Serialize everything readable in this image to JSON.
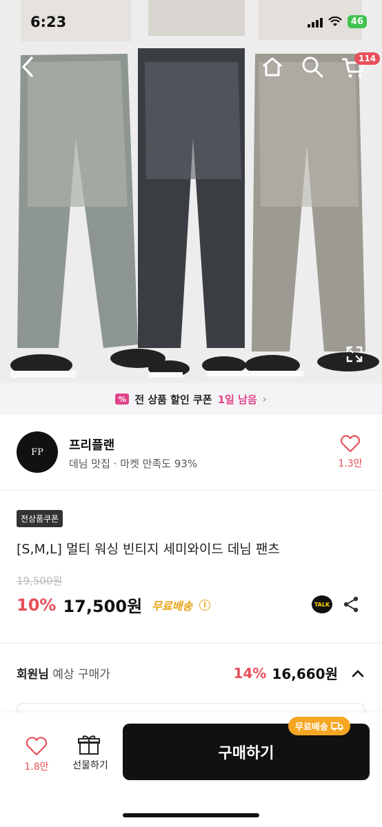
{
  "status_bar": {
    "time": "6:23",
    "battery": "46"
  },
  "nav": {
    "cart_count": "114"
  },
  "coupon_strip": {
    "text": "전 상품 할인 쿠폰",
    "days": "1일 남음"
  },
  "store": {
    "logo_text": "FP",
    "name": "프리플랜",
    "meta": "데님 맛집 · 마켓 만족도 93%",
    "like_count": "1.3만"
  },
  "product": {
    "badge": "전상품쿠폰",
    "title": "[S,M,L] 멀티 워싱 빈티지 세미와이드 데님 팬츠",
    "original_price": "19,500원",
    "discount": "10%",
    "price": "17,500원",
    "free_shipping": "무료배송"
  },
  "member": {
    "label_bold": "회원님",
    "label_sub": "예상 구매가",
    "discount": "14%",
    "price": "16,660원"
  },
  "bottom_bar": {
    "like_count": "1.8만",
    "gift_label": "선물하기",
    "buy_label": "구매하기",
    "ship_chip": "무료배송"
  },
  "icons": [
    "back-icon",
    "home-icon",
    "search-icon",
    "cart-icon",
    "expand-icon",
    "heart-icon",
    "gift-icon",
    "share-icon",
    "kakaotalk-icon",
    "chevron-up-icon",
    "truck-icon"
  ],
  "colors": {
    "accent_red": "#e8505b",
    "free_ship_orange": "#e6a316",
    "coupon_pink": "#e0448a",
    "buy_button": "#111111"
  }
}
